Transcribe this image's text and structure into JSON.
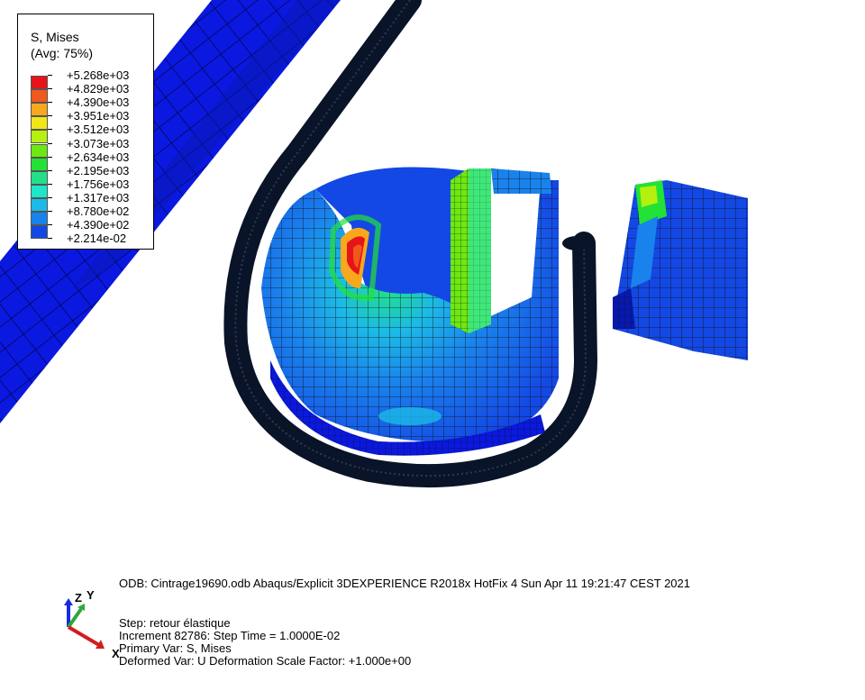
{
  "legend": {
    "title": "S, Mises",
    "subtitle": "(Avg: 75%)",
    "levels": [
      {
        "label": "+5.268e+03",
        "color": "#e8121a"
      },
      {
        "label": "+4.829e+03",
        "color": "#f0581e"
      },
      {
        "label": "+4.390e+03",
        "color": "#f7a81c"
      },
      {
        "label": "+3.951e+03",
        "color": "#f2e61a"
      },
      {
        "label": "+3.512e+03",
        "color": "#b6f00e"
      },
      {
        "label": "+3.073e+03",
        "color": "#6ce812"
      },
      {
        "label": "+2.634e+03",
        "color": "#22e236"
      },
      {
        "label": "+2.195e+03",
        "color": "#22e08a"
      },
      {
        "label": "+1.756e+03",
        "color": "#1ee6c8"
      },
      {
        "label": "+1.317e+03",
        "color": "#1cbae6"
      },
      {
        "label": "+8.780e+02",
        "color": "#1a82ec"
      },
      {
        "label": "+4.390e+02",
        "color": "#1448e4"
      },
      {
        "label": "+2.214e-02",
        "color": "#0a18e0"
      }
    ]
  },
  "info": {
    "odb_line": "ODB: Cintrage19690.odb    Abaqus/Explicit 3DEXPERIENCE R2018x HotFix 4    Sun Apr 11 19:21:47 CEST 2021",
    "step": "Step: retour élastique",
    "increment": "Increment    82786: Step Time =    1.0000E-02",
    "primary_var": "Primary Var: S, Mises",
    "deformed_var": "Deformed Var: U   Deformation Scale Factor: +1.000e+00"
  },
  "triad": {
    "z_label": "Z",
    "y_label": "Y",
    "x_label": "X",
    "colors": {
      "z": "#1a2be0",
      "y": "#2ea83a",
      "x": "#d01e1e"
    }
  },
  "colors": {
    "tube_dark": "#0a1428",
    "beam_blue": "#0a18e0",
    "mesh_line": "#111111"
  }
}
